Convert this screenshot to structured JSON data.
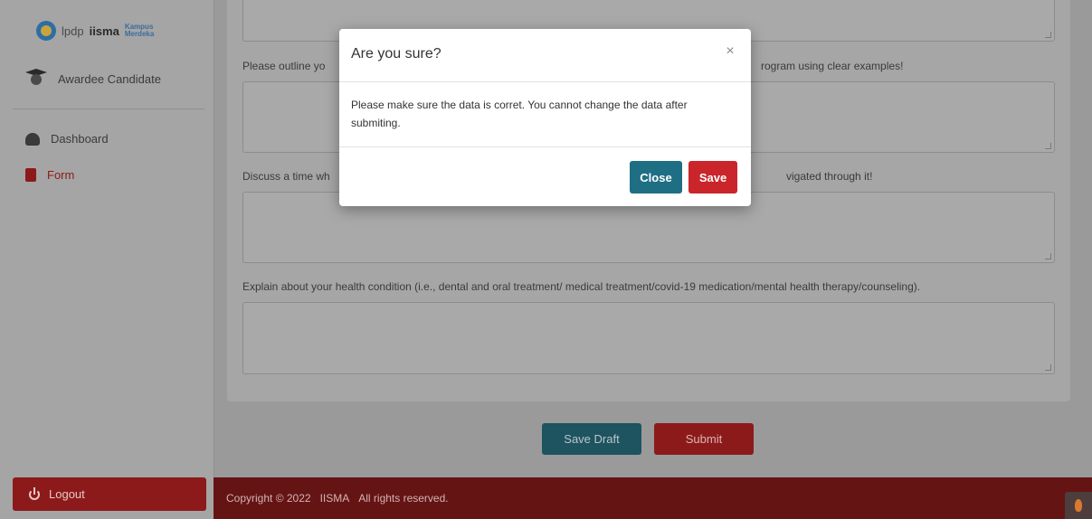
{
  "sidebar": {
    "logos": {
      "lpdp": "lpdp",
      "iisma": "iisma",
      "kampus": "Kampus Merdeka"
    },
    "user_role": "Awardee Candidate",
    "nav": [
      {
        "label": "Dashboard",
        "icon": "tachometer-icon",
        "active": false
      },
      {
        "label": "Form",
        "icon": "clipboard-icon",
        "active": true
      }
    ],
    "logout_label": "Logout"
  },
  "form": {
    "questions": [
      {
        "label_start": "Please outline yo",
        "label_end": "rogram using clear examples!"
      },
      {
        "label_start": "Discuss a time wh",
        "label_end": "vigated through it!"
      },
      {
        "label": "Explain about your health condition (i.e., dental and oral treatment/ medical treatment/covid-19 medication/mental health therapy/counseling)."
      }
    ],
    "save_draft_label": "Save Draft",
    "submit_label": "Submit"
  },
  "footer": {
    "copyright": "Copyright © 2022",
    "brand": "IISMA",
    "rights": "All rights reserved."
  },
  "modal": {
    "title": "Are you sure?",
    "close_x": "×",
    "message": "Please make sure the data is corret. You cannot change the data after submiting.",
    "close_label": "Close",
    "save_label": "Save"
  },
  "colors": {
    "primary_teal": "#1f6f84",
    "danger_red": "#c9252b",
    "footer_maroon": "#651414",
    "sidebar_active": "#8d1a1a"
  }
}
